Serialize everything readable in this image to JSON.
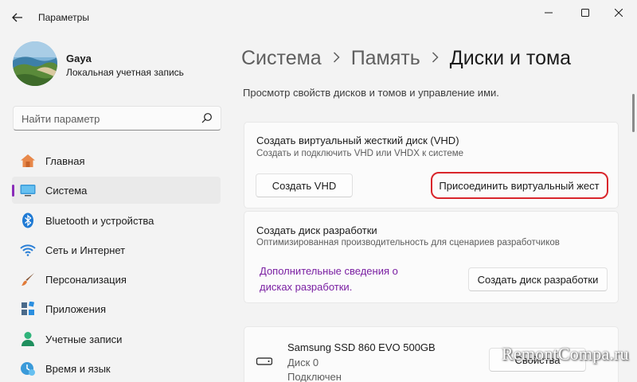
{
  "window": {
    "title": "Параметры",
    "back_icon": "arrow-left-icon",
    "controls": [
      "minimize-icon",
      "maximize-icon",
      "close-icon"
    ]
  },
  "profile": {
    "name": "Gaya",
    "subtitle": "Локальная учетная запись"
  },
  "search": {
    "placeholder": "Найти параметр",
    "icon": "search-icon"
  },
  "nav": {
    "items": [
      {
        "label": "Главная",
        "icon": "home-icon"
      },
      {
        "label": "Система",
        "icon": "monitor-icon",
        "selected": true
      },
      {
        "label": "Bluetooth и устройства",
        "icon": "bluetooth-icon"
      },
      {
        "label": "Сеть и Интернет",
        "icon": "wifi-icon"
      },
      {
        "label": "Персонализация",
        "icon": "brush-icon"
      },
      {
        "label": "Приложения",
        "icon": "apps-icon"
      },
      {
        "label": "Учетные записи",
        "icon": "person-icon"
      },
      {
        "label": "Время и язык",
        "icon": "clock-globe-icon"
      }
    ],
    "accent_color": "#8a2cb9"
  },
  "breadcrumb": {
    "items": [
      "Система",
      "Память",
      "Диски и тома"
    ]
  },
  "page": {
    "description": "Просмотр свойств дисков и томов и управление ими."
  },
  "vhd_card": {
    "title": "Создать виртуальный жесткий диск (VHD)",
    "subtitle": "Создать и подключить VHD или VHDX к системе",
    "create_button": "Создать VHD",
    "attach_button": "Присоединить виртуальный жест",
    "highlight_color": "#d9262c"
  },
  "dev_card": {
    "title": "Создать диск разработки",
    "subtitle": "Оптимизированная производительность для сценариев разработчиков",
    "link_line1": "Дополнительные сведения о",
    "link_line2": "дисках разработки.",
    "create_button": "Создать диск разработки"
  },
  "drive_card": {
    "name": "Samsung SSD 860 EVO 500GB",
    "disk": "Диск 0",
    "status": "Подключен",
    "properties_button": "Свойства",
    "icon": "drive-icon"
  },
  "watermark": "RemontCompa.ru"
}
